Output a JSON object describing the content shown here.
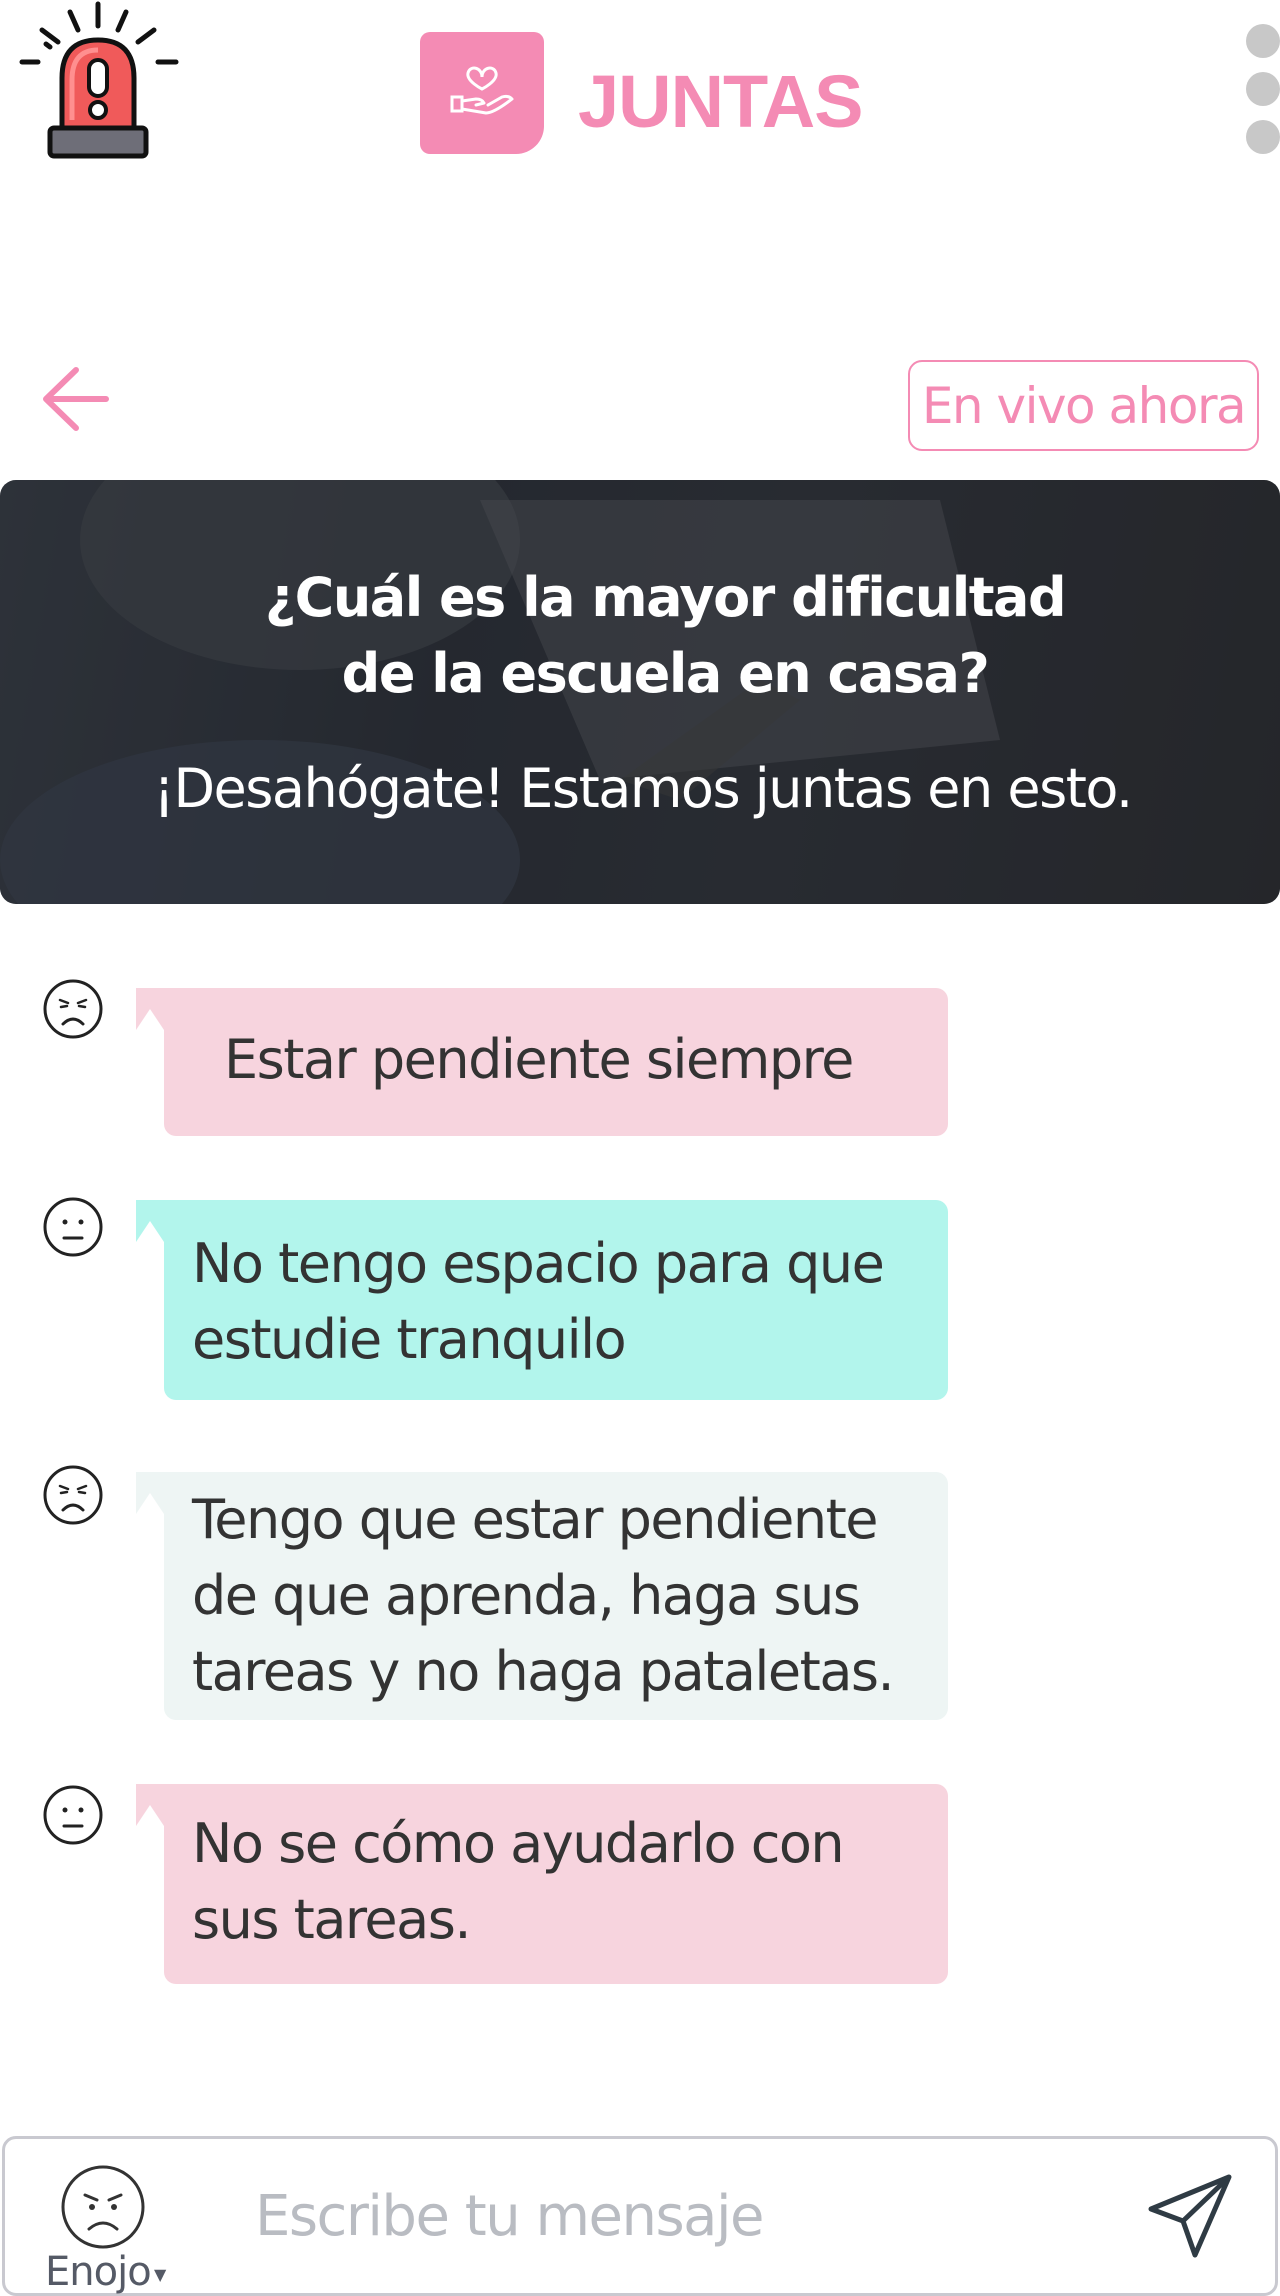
{
  "header": {
    "brand": "JUNTAS",
    "alarm_icon": "alarm-siren-icon",
    "logo_icon": "heart-in-hand-icon",
    "menu_icon": "kebab-menu-icon",
    "brand_color": "#f48bb4"
  },
  "nav": {
    "back_icon": "arrow-left-icon",
    "live_label": "En vivo ahora"
  },
  "banner": {
    "title": "¿Cuál es la mayor dificultad\nde la escuela en casa?",
    "subtitle": "¡Desahógate! Estamos juntas en esto."
  },
  "messages": [
    {
      "mood": "sad-face-icon",
      "text": "Estar pendiente siempre",
      "color": "#f7d4de"
    },
    {
      "mood": "neutral-face-icon",
      "text": "No tengo espacio para que estudie tranquilo",
      "color": "#b2f5ec"
    },
    {
      "mood": "sad-face-icon",
      "text": "Tengo que estar pendiente de que aprenda, haga sus tareas y no haga pataletas.",
      "color": "#eef5f4"
    },
    {
      "mood": "neutral-face-icon",
      "text": "No se cómo ayudarlo con sus tareas.",
      "color": "#f7d4de"
    }
  ],
  "composer": {
    "mood_label": "Enojo",
    "mood_icon": "angry-face-icon",
    "placeholder": "Escribe tu mensaje",
    "send_icon": "send-icon"
  }
}
